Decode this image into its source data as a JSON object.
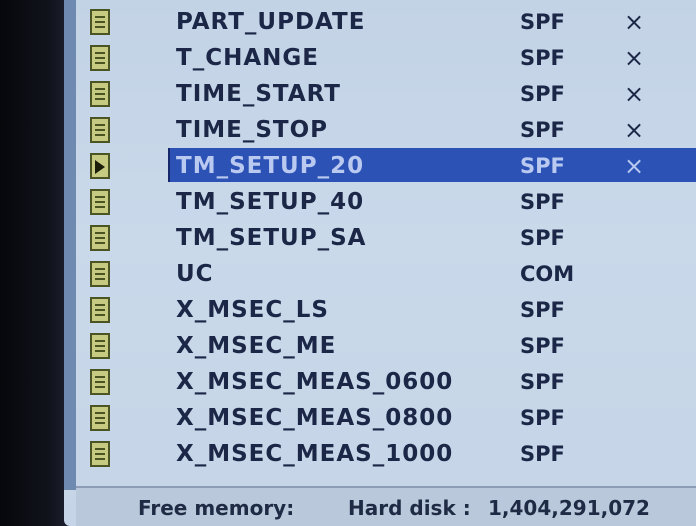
{
  "files": [
    {
      "name": "PART_UPDATE",
      "type": "SPF",
      "mark": "×",
      "icon": "program-file-icon"
    },
    {
      "name": "T_CHANGE",
      "type": "SPF",
      "mark": "×",
      "icon": "program-file-icon"
    },
    {
      "name": "TIME_START",
      "type": "SPF",
      "mark": "×",
      "icon": "program-file-icon"
    },
    {
      "name": "TIME_STOP",
      "type": "SPF",
      "mark": "×",
      "icon": "program-file-icon"
    },
    {
      "name": "TM_SETUP_20",
      "type": "SPF",
      "mark": "×",
      "icon": "play-file-icon",
      "selected": true
    },
    {
      "name": "TM_SETUP_40",
      "type": "SPF",
      "mark": "",
      "icon": "program-file-icon"
    },
    {
      "name": "TM_SETUP_SA",
      "type": "SPF",
      "mark": "",
      "icon": "program-file-icon"
    },
    {
      "name": "UC",
      "type": "COM",
      "mark": "",
      "icon": "program-file-icon"
    },
    {
      "name": "X_MSEC_LS",
      "type": "SPF",
      "mark": "",
      "icon": "program-file-icon"
    },
    {
      "name": "X_MSEC_ME",
      "type": "SPF",
      "mark": "",
      "icon": "program-file-icon"
    },
    {
      "name": "X_MSEC_MEAS_0600",
      "type": "SPF",
      "mark": "",
      "icon": "program-file-icon"
    },
    {
      "name": "X_MSEC_MEAS_0800",
      "type": "SPF",
      "mark": "",
      "icon": "program-file-icon"
    },
    {
      "name": "X_MSEC_MEAS_1000",
      "type": "SPF",
      "mark": "",
      "icon": "program-file-icon"
    }
  ],
  "status": {
    "free_memory_label": "Free memory:",
    "hard_disk_label": "Hard disk :",
    "hard_disk_value": "1,404,291,072"
  },
  "colors": {
    "selection": "#2c52b6",
    "background": "#c9d9ea",
    "text": "#1c2646"
  }
}
